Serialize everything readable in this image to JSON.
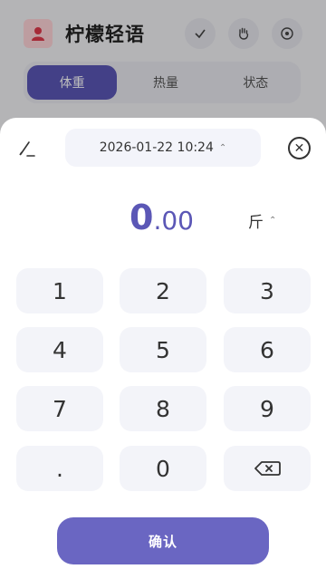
{
  "app": {
    "title": "柠檬轻语",
    "tabs": [
      {
        "label": "体重"
      },
      {
        "label": "热量"
      },
      {
        "label": "状态"
      }
    ]
  },
  "sheet": {
    "datetime": "2026-01-22 10:24",
    "value_int": "0",
    "value_frac": ".00",
    "unit": "斤",
    "keys": [
      "1",
      "2",
      "3",
      "4",
      "5",
      "6",
      "7",
      "8",
      "9",
      ".",
      "0"
    ],
    "confirm_label": "确认"
  },
  "colors": {
    "accent": "#5b57b6",
    "confirm": "#6a66c2",
    "key_bg": "#f3f4f9"
  },
  "icons": {
    "edit": "pen-icon",
    "close": "close-circle-icon",
    "backspace": "backspace-icon"
  }
}
